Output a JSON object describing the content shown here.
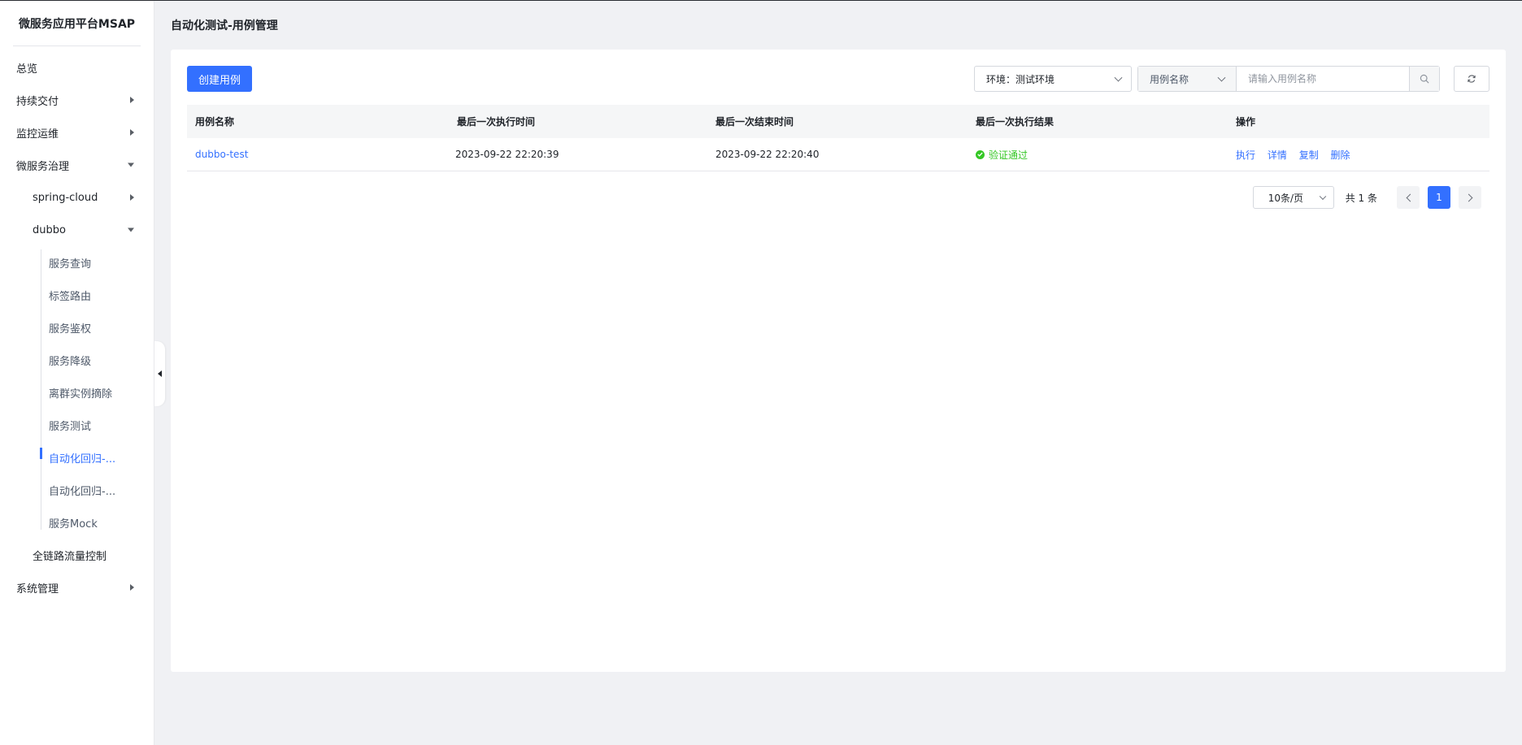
{
  "app": {
    "brand": "微服务应用平台MSAP"
  },
  "sidebar": {
    "items": [
      {
        "label": "总览"
      },
      {
        "label": "持续交付"
      },
      {
        "label": "监控运维"
      },
      {
        "label": "微服务治理"
      },
      {
        "label": "spring-cloud"
      },
      {
        "label": "dubbo"
      },
      {
        "label": "服务查询"
      },
      {
        "label": "标签路由"
      },
      {
        "label": "服务鉴权"
      },
      {
        "label": "服务降级"
      },
      {
        "label": "离群实例摘除"
      },
      {
        "label": "服务测试"
      },
      {
        "label": "自动化回归-..."
      },
      {
        "label": "自动化回归-..."
      },
      {
        "label": "服务Mock"
      },
      {
        "label": "全链路流量控制"
      },
      {
        "label": "系统管理"
      }
    ]
  },
  "page": {
    "title": "自动化测试-用例管理"
  },
  "toolbar": {
    "create_label": "创建用例",
    "env_label": "环境：测试环境",
    "field_label": "用例名称",
    "search_placeholder": "请输入用例名称"
  },
  "table": {
    "headers": [
      "用例名称",
      "最后一次执行时间",
      "最后一次结束时间",
      "最后一次执行结果",
      "操作"
    ],
    "rows": [
      {
        "name": "dubbo-test",
        "exec_time": "2023-09-22 22:20:39",
        "end_time": "2023-09-22 22:20:40",
        "result": "验证通过",
        "ops": [
          "执行",
          "详情",
          "复制",
          "删除"
        ]
      }
    ]
  },
  "pagination": {
    "page_size": "10条/页",
    "total": "共 1 条",
    "current": "1"
  },
  "colors": {
    "primary": "#3370ff",
    "success": "#34c724"
  }
}
